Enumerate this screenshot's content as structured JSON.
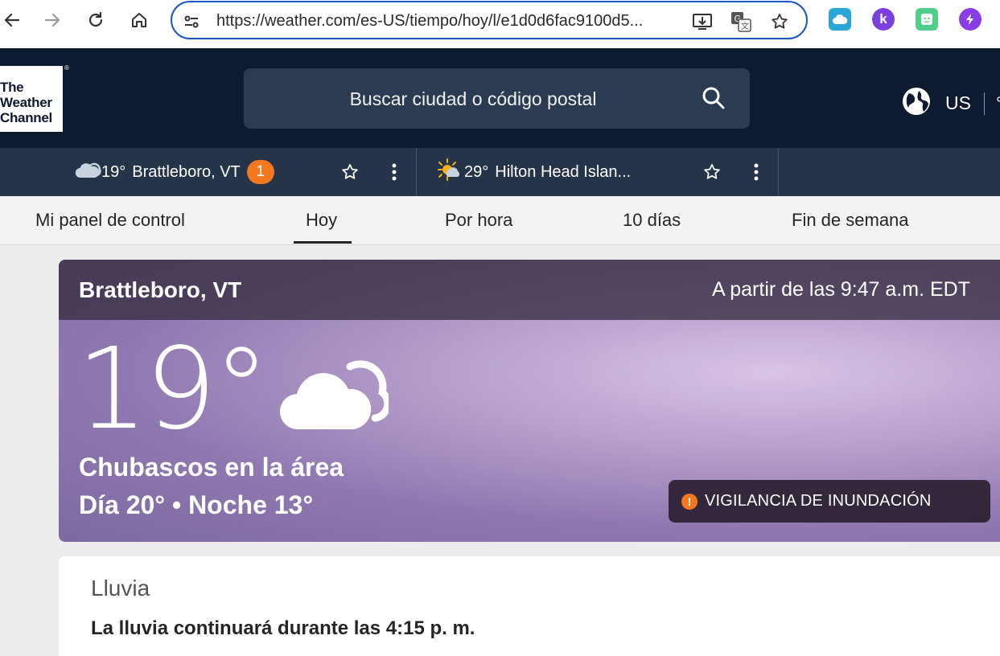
{
  "browser": {
    "url": "https://weather.com/es-US/tiempo/hoy/l/e1d0d6fac9100d5..."
  },
  "header": {
    "logo_lines": [
      "The",
      "Weather",
      "Channel"
    ],
    "logo_reg": "®",
    "search_placeholder": "Buscar ciudad o código postal",
    "region_label": "US",
    "unit_fragment": "°"
  },
  "locations": [
    {
      "temp": "19°",
      "name": "Brattleboro, VT",
      "alert_count": "1",
      "icon": "cloudy-icon"
    },
    {
      "temp": "29°",
      "name": "Hilton Head Islan...",
      "icon": "partly-sunny-icon"
    }
  ],
  "tabs": [
    {
      "label": "Mi panel de control"
    },
    {
      "label": "Hoy",
      "active": true
    },
    {
      "label": "Por hora"
    },
    {
      "label": "10 días"
    },
    {
      "label": "Fin de semana"
    }
  ],
  "current": {
    "city": "Brattleboro, VT",
    "as_of": "A partir de las 9:47 a.m. EDT",
    "temperature": "19°",
    "phrase": "Chubascos en la área",
    "hi_lo": "Día 20° • Noche 13°",
    "alert_text": "VIGILANCIA DE INUNDACIÓN",
    "alert_symbol": "!",
    "icon": "cloudy-icon"
  },
  "rain": {
    "title": "Lluvia",
    "text": "La lluvia continuará durante las 4:15 p. m."
  },
  "colors": {
    "header_bg": "#0e1a30",
    "location_bar_bg": "#253448",
    "alert_orange": "#f4781f",
    "focus_blue": "#1a56c7"
  }
}
